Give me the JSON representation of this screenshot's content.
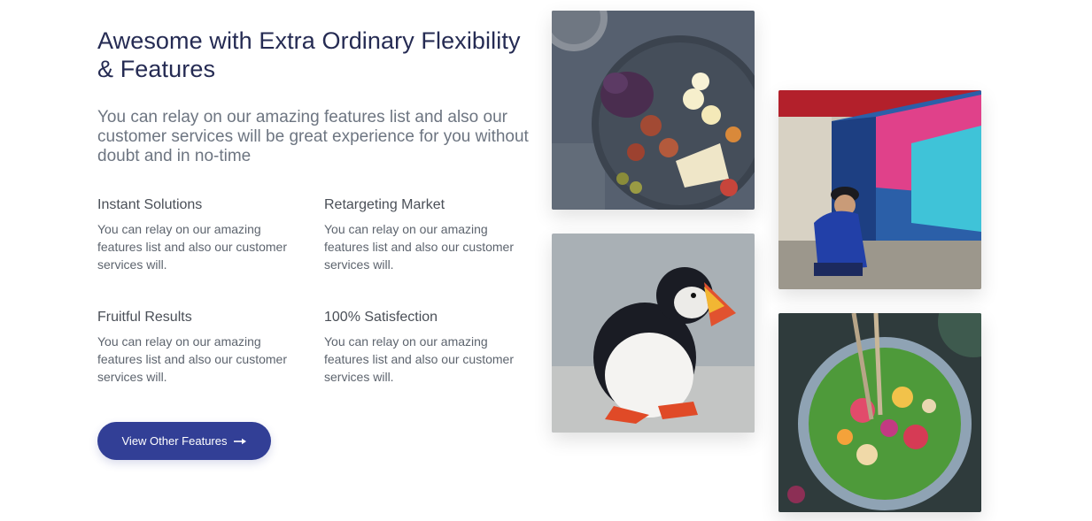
{
  "section": {
    "heading": "Awesome with Extra Ordinary Flexibility & Features",
    "lead": "You can relay on our amazing features list and also our customer services will be great experience for you without doubt and in no-time"
  },
  "features": [
    {
      "title": "Instant Solutions",
      "text": "You can relay on our amazing features list and also our customer services will."
    },
    {
      "title": "Retargeting Market",
      "text": "You can relay on our amazing features list and also our customer services will."
    },
    {
      "title": "Fruitful Results",
      "text": "You can relay on our amazing features list and also our customer services will."
    },
    {
      "title": "100% Satisfection",
      "text": "You can relay on our amazing features list and also our customer services will."
    }
  ],
  "cta": {
    "label": "View Other Features",
    "icon": "arrow-right-icon"
  },
  "gallery": [
    {
      "name": "food-platter-photo"
    },
    {
      "name": "street-mural-child-photo"
    },
    {
      "name": "puffin-photo"
    },
    {
      "name": "salad-bowl-photo"
    }
  ],
  "colors": {
    "heading": "#252b53",
    "lead": "#6d7581",
    "body_text": "#5d646e",
    "button": "#323f96"
  }
}
